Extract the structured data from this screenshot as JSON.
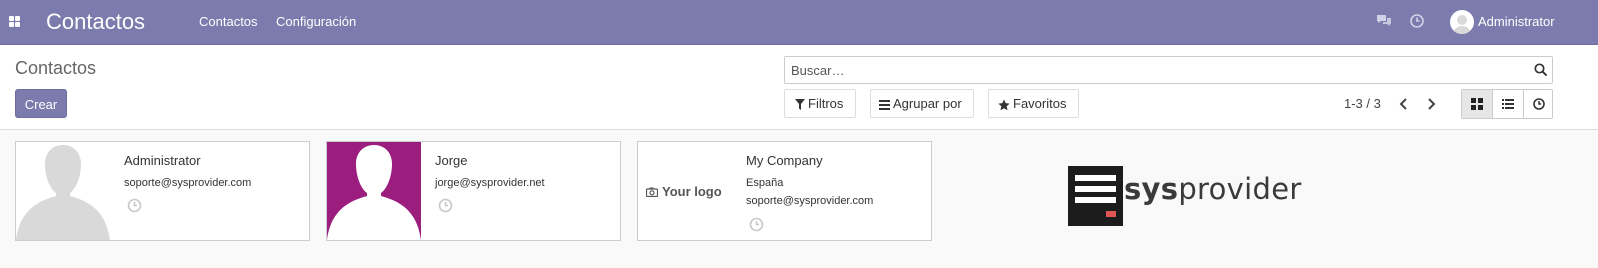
{
  "navbar": {
    "brand": "Contactos",
    "menu": [
      "Contactos",
      "Configuración"
    ],
    "user": "Administrator",
    "icons": [
      "apps-icon",
      "chat-icon",
      "clock-icon"
    ]
  },
  "control_panel": {
    "breadcrumb": "Contactos",
    "create_label": "Crear",
    "search_placeholder": "Buscar…",
    "filters_label": "Filtros",
    "group_by_label": "Agrupar por",
    "favorites_label": "Favoritos",
    "pager_value": "1-3 / 3",
    "views": [
      "kanban",
      "list",
      "activity"
    ],
    "active_view": "kanban"
  },
  "cards": [
    {
      "name": "Administrator",
      "lines": [
        "soporte@sysprovider.com"
      ],
      "image": "placeholder-avatar"
    },
    {
      "name": "Jorge",
      "lines": [
        "jorge@sysprovider.net"
      ],
      "image": "purple-avatar"
    },
    {
      "name": "My Company",
      "lines": [
        "España",
        "soporte@sysprovider.com"
      ],
      "image": "your-logo"
    }
  ],
  "logo": {
    "text_bold": "sys",
    "text_regular": "provider",
    "image_text": "Your logo"
  },
  "colors": {
    "navbar": "#7c7bad",
    "avatar_purple": "#9b1d7e",
    "avatar_placeholder": "#d9d9d9"
  }
}
